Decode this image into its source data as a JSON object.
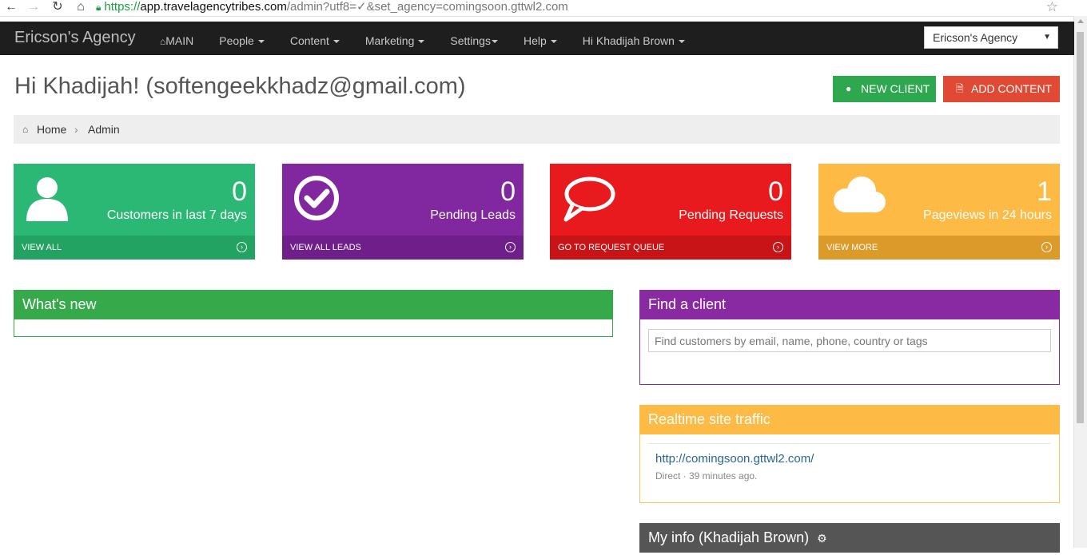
{
  "browser": {
    "back_icon": "arrow-left-icon",
    "forward_icon": "arrow-right-icon",
    "reload_icon": "reload-icon",
    "home_icon": "home-icon",
    "url_scheme": "https://",
    "url_host": "app.travelagencytribes.com",
    "url_path": "/admin?utf8=✓&set_agency=comingsoon.gttwl2.com",
    "star_icon": "bookmark-star-icon"
  },
  "navbar": {
    "brand": "Ericson's Agency",
    "items": [
      {
        "label": "MAIN",
        "icon": "home-icon",
        "caret": false
      },
      {
        "label": "People",
        "caret": true
      },
      {
        "label": "Content",
        "caret": true
      },
      {
        "label": "Marketing",
        "caret": true
      },
      {
        "label": "Settings",
        "caret": true
      },
      {
        "label": "Help",
        "caret": true
      },
      {
        "label": "Hi Khadijah Brown",
        "caret": true
      }
    ],
    "agency_select": "Ericson's Agency"
  },
  "header": {
    "greeting": "Hi Khadijah! (softengeekkhadz@gmail.com)",
    "new_client": "NEW CLIENT",
    "add_content": "ADD CONTENT"
  },
  "breadcrumb": {
    "home": "Home",
    "separator": "›",
    "current": "Admin"
  },
  "tiles": [
    {
      "value": "0",
      "label": "Customers in last 7 days",
      "footer": "VIEW ALL",
      "icon": "user-icon",
      "color": "#2bb875"
    },
    {
      "value": "0",
      "label": "Pending Leads",
      "footer": "VIEW ALL LEADS",
      "icon": "check-circle-icon",
      "color": "#8128a0"
    },
    {
      "value": "0",
      "label": "Pending Requests",
      "footer": "GO TO REQUEST QUEUE",
      "icon": "speech-bubble-icon",
      "color": "#e81a1e"
    },
    {
      "value": "1",
      "label": "Pageviews in 24 hours",
      "footer": "VIEW MORE",
      "icon": "cloud-icon",
      "color": "#fdba44"
    }
  ],
  "panels": {
    "whats_new": {
      "title": "What's new"
    },
    "find_client": {
      "title": "Find a client",
      "placeholder": "Find customers by email, name, phone, country or tags"
    },
    "traffic": {
      "title": "Realtime site traffic",
      "url": "http://comingsoon.gttwl2.com/",
      "meta": "Direct · 39 minutes ago."
    },
    "my_info": {
      "title": "My info (Khadijah Brown)"
    }
  }
}
